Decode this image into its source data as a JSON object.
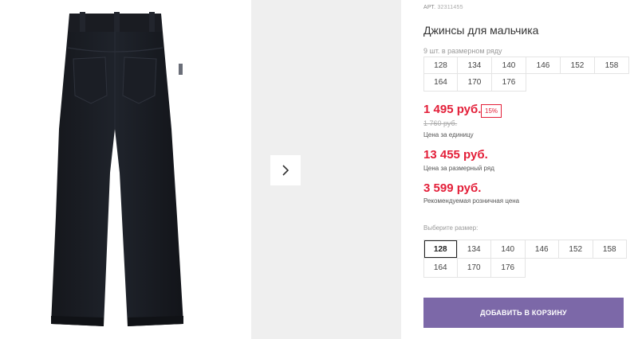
{
  "product": {
    "article_label": "АРТ.",
    "article_number": "32311455",
    "title": "Джинсы для мальчика"
  },
  "pack": {
    "note": "9 шт. в размерном ряду",
    "sizes": [
      "128",
      "134",
      "140",
      "146",
      "152",
      "158",
      "164",
      "170",
      "176"
    ]
  },
  "prices": {
    "unit_price": "1 495 руб.",
    "discount_badge": "15%",
    "old_price": "1 760 руб.",
    "unit_caption": "Цена за единицу",
    "pack_price": "13 455 руб.",
    "pack_caption": "Цена за размерный ряд",
    "retail_price": "3 599 руб.",
    "retail_caption": "Рекомендуемая розничная цена"
  },
  "size_selector": {
    "label": "Выберите размер:",
    "selected": "128",
    "sizes": [
      "128",
      "134",
      "140",
      "146",
      "152",
      "158",
      "164",
      "170",
      "176"
    ]
  },
  "cart_button": {
    "label": "ДОБАВИТЬ В КОРЗИНУ"
  },
  "colors": {
    "price_red": "#e31e38",
    "button_purple": "#7c68a8",
    "gallery_gray": "#efefef"
  },
  "icons": {
    "next": "chevron-right-icon"
  }
}
